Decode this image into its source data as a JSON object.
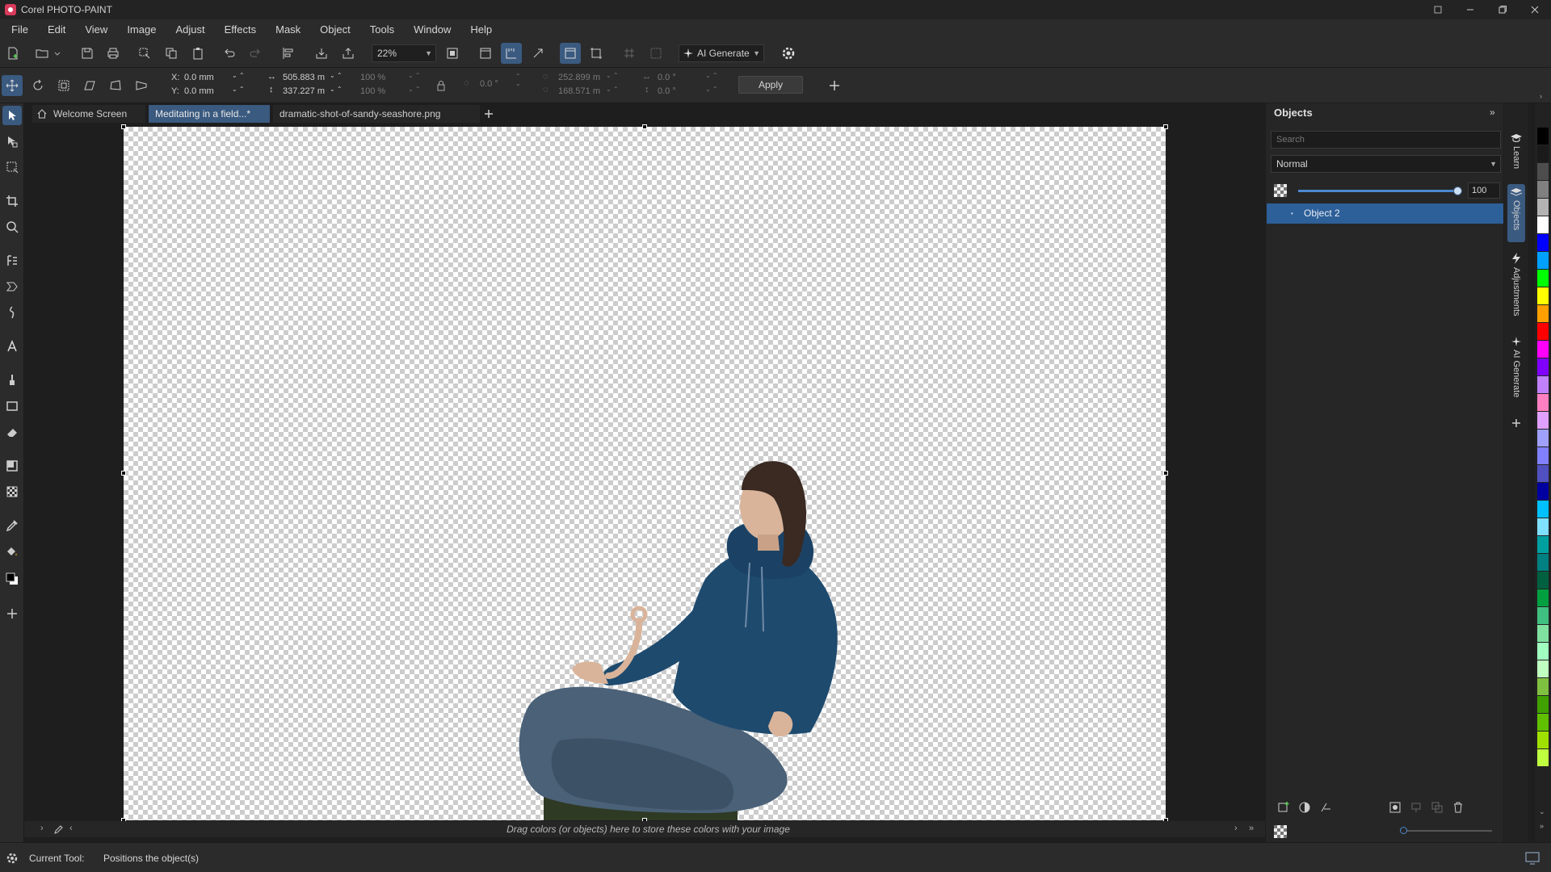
{
  "app": {
    "title": "Corel PHOTO-PAINT",
    "accent": "#3a5a80"
  },
  "menu": [
    "File",
    "Edit",
    "View",
    "Image",
    "Adjust",
    "Effects",
    "Mask",
    "Object",
    "Tools",
    "Window",
    "Help"
  ],
  "toolbar": {
    "zoom": "22%",
    "ai_generate": "AI Generate"
  },
  "property_bar": {
    "x": "0.0 mm",
    "y": "0.0 mm",
    "width": "505.883 m",
    "height": "337.227 m",
    "scale_w": "100 %",
    "scale_h": "100 %",
    "rotation": "0.0 °",
    "center_x": "252.899 m",
    "center_y": "168.571 m",
    "skew_h": "0.0 °",
    "skew_v": "0.0 °",
    "apply_label": "Apply",
    "x_label": "X:",
    "y_label": "Y:"
  },
  "tabs": [
    {
      "label": "Welcome Screen"
    },
    {
      "label": "Meditating in a field...*"
    },
    {
      "label": "dramatic-shot-of-sandy-seashore.png"
    }
  ],
  "color_hint": "Drag colors (or objects) here to store these colors with your image",
  "status": {
    "current_tool_label": "Current Tool:",
    "current_tool_value": "Positions the object(s)"
  },
  "objects_docker": {
    "title": "Objects",
    "search_placeholder": "Search",
    "blend_mode": "Normal",
    "opacity": "100",
    "opacity_fraction": 1.0,
    "layers": [
      {
        "name": "Object 2"
      }
    ]
  },
  "docker_tabs": [
    "Learn",
    "Objects",
    "Adjustments",
    "AI Generate"
  ],
  "palette": [
    "#000000",
    "#1a1a1a",
    "#4d4d4d",
    "#808080",
    "#b3b3b3",
    "#ffffff",
    "#0000ff",
    "#00a0ff",
    "#00ff00",
    "#ffff00",
    "#ffa000",
    "#ff0000",
    "#ff00ff",
    "#8000ff",
    "#c080ff",
    "#ff80c0",
    "#e0a0ff",
    "#a0a0ff",
    "#8080ff",
    "#5050c0",
    "#0000a0",
    "#00c0ff",
    "#80e0ff",
    "#00a0a0",
    "#008080",
    "#006040",
    "#00a040",
    "#40c080",
    "#80e0a0",
    "#a0ffc0",
    "#c0ffc0",
    "#80c040",
    "#40a000",
    "#60c000",
    "#a0e000",
    "#c0ff40"
  ]
}
